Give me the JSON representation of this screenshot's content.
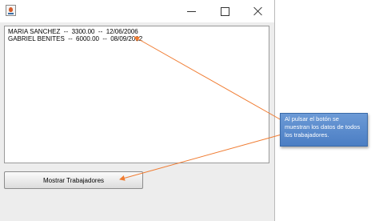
{
  "window": {
    "icon": "java-cup-icon",
    "controls": {
      "minimize_icon": "minimize-icon",
      "maximize_icon": "maximize-icon",
      "close_icon": "close-icon"
    }
  },
  "output": {
    "lines": [
      "MARIA SANCHEZ  --  3300.00  --  12/06/2006",
      "GABRIEL BENITES  --  6000.00  --  08/09/2012"
    ]
  },
  "button": {
    "label": "Mostrar Trabajadores"
  },
  "callout": {
    "text": "Al pulsar el botón se muestran los datos de todos los trabajadores.",
    "color": "#5b8bd0",
    "arrow_color": "#f07c32"
  }
}
